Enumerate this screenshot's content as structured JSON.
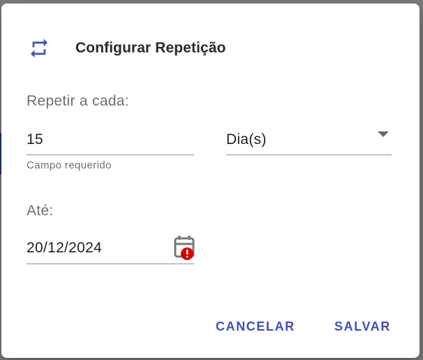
{
  "dialog": {
    "title": "Configurar Repetição",
    "icon": "repeat-icon"
  },
  "repeat": {
    "label": "Repetir a cada:",
    "interval_value": "15",
    "helper_text": "Campo requerido",
    "unit_value": "Dia(s)"
  },
  "until": {
    "label": "Até:",
    "date_value": "20/12/2024",
    "icon": "calendar-error-icon"
  },
  "actions": {
    "cancel_label": "CANCELAR",
    "save_label": "SALVAR"
  },
  "colors": {
    "accent": "#3f51b5",
    "error": "#d50000"
  }
}
